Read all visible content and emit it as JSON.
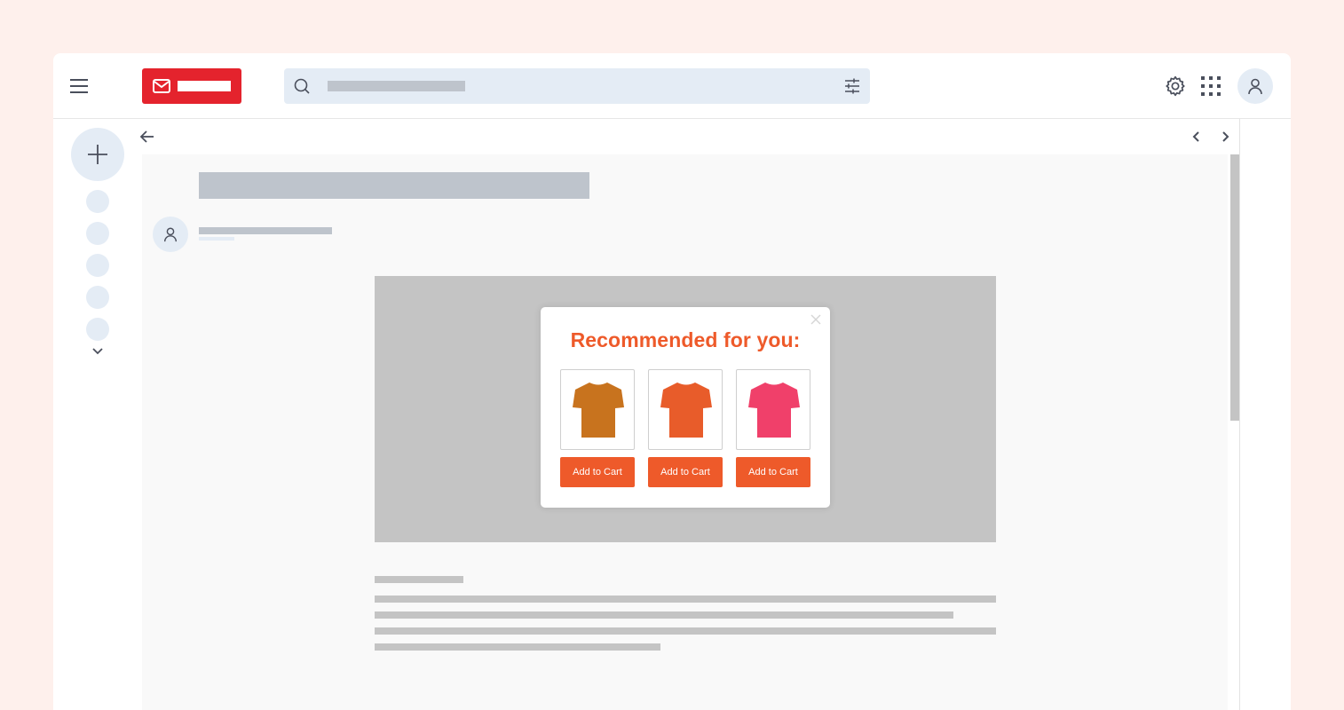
{
  "header": {
    "menu_icon": "hamburger-menu-icon",
    "logo_icon": "mail-envelope-icon",
    "logo_color": "#e4232d",
    "search": {
      "icon": "search-icon",
      "filter_icon": "tune-sliders-icon",
      "placeholder": ""
    },
    "actions": [
      {
        "name": "settings",
        "icon": "gear-icon"
      },
      {
        "name": "apps",
        "icon": "grid-apps-icon"
      },
      {
        "name": "account",
        "icon": "user-icon"
      }
    ]
  },
  "rail": {
    "compose_icon": "plus-icon",
    "items_count": 5,
    "more_icon": "chevron-down-icon"
  },
  "toolbar": {
    "back_icon": "arrow-left-icon",
    "prev_icon": "chevron-left-icon",
    "next_icon": "chevron-right-icon"
  },
  "message": {
    "sender_icon": "user-icon",
    "ad_popup": {
      "title": "Recommended for you:",
      "close_icon": "close-icon",
      "accent_color": "#ee5a2a",
      "products": [
        {
          "name": "T-shirt",
          "color": "#c8731e",
          "button_label": "Add to Cart"
        },
        {
          "name": "T-shirt",
          "color": "#e85c2a",
          "button_label": "Add to Cart"
        },
        {
          "name": "T-shirt",
          "color": "#f0406a",
          "button_label": "Add to Cart"
        }
      ]
    }
  },
  "colors": {
    "page_bg": "#fef0ec",
    "placeholder_gray": "#bec4cc",
    "light_blue": "#e4ecf5",
    "icon_gray": "#4a4f5c"
  }
}
